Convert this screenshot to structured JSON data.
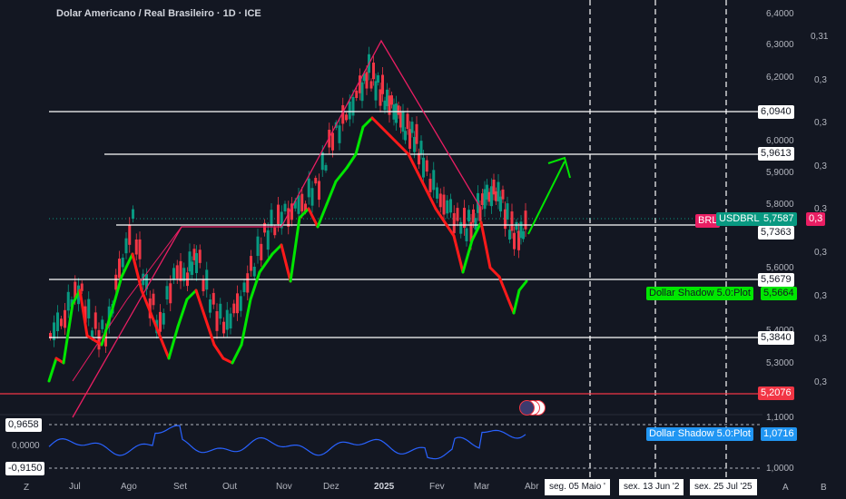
{
  "header": {
    "title": "Dolar Americano / Real Brasileiro · 1D · ICE"
  },
  "x_labels": [
    "Jul",
    "Ago",
    "Set",
    "Out",
    "Nov",
    "Dez",
    "2025",
    "Fev",
    "Mar",
    "Abr"
  ],
  "price_axis": [
    "6,4000",
    "6,3000",
    "6,2000",
    "6,0000",
    "5,9000",
    "5,8000",
    "5,6000",
    "5,4000",
    "5,3000",
    "1,1000",
    "1,0000"
  ],
  "right_axis": [
    "0,31",
    "0,3",
    "0,3",
    "0,3",
    "0,3",
    "0,3",
    "0,3",
    "0,3",
    "0,3",
    "0,3"
  ],
  "price_tags": {
    "l1": "6,0940",
    "l2": "5,9613",
    "l3": "5,7363",
    "l4": "5,5679",
    "l5": "5,3840",
    "l6": "5,2076",
    "current": "5,7587",
    "symbol": "USDBRL",
    "brl_prefix": "BRL",
    "brl_value": "0,3",
    "shadow_name": "Dollar Shadow 5.0:Plot",
    "shadow_value": "5,5664",
    "osc_name": "Dollar Shadow 5.0:Plot",
    "osc_value": "1,0716"
  },
  "osc_labels": {
    "top": "0,9658",
    "mid": "0,0000",
    "bot": "-0,9150"
  },
  "dates": [
    "seg. 05 Maio '",
    "sex. 13 Jun '2",
    "sex. 25 Jul '25"
  ],
  "corner_icons": [
    "Z",
    "A",
    "B"
  ],
  "colors": {
    "up": "#089981",
    "down": "#f23645",
    "shadow_up": "#00e600",
    "shadow_down": "#ff1a1a",
    "pink": "#e91e63",
    "osc": "#2962ff"
  },
  "chart_data": {
    "type": "candlestick",
    "title": "Dolar Americano / Real Brasileiro · 1D · ICE",
    "ylim": [
      5.2,
      6.4
    ],
    "horizontal_levels": [
      6.094,
      5.9613,
      5.7363,
      5.5679,
      5.384,
      5.2076
    ],
    "current_price": 5.7587
  }
}
